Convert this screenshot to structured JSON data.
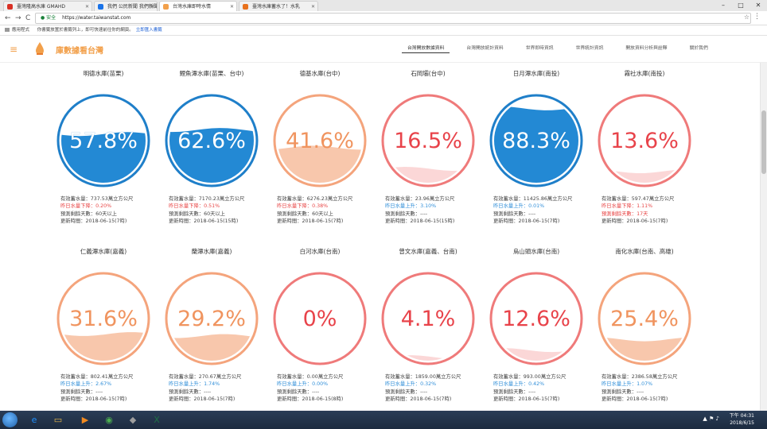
{
  "browser": {
    "tabs": [
      {
        "label": "臺灣隆高水庫 GMAHD",
        "color": "#d93025"
      },
      {
        "label": "我們 公民新聞 我們新聞",
        "color": "#1a73e8"
      },
      {
        "label": "台灣水庫即時水情",
        "color": "#f2a04b",
        "active": true
      },
      {
        "label": "臺灣水庫蓄水了！水乳",
        "color": "#e8711c"
      }
    ],
    "nav_back": "←",
    "nav_forward": "→",
    "nav_reload": "C",
    "secure_label": "● 安全",
    "url": "https://water.taiwanstat.com",
    "bookmarks_label": "應用程式",
    "bookmarks_text": "你書籤放置於書籤列上，即可快速前往你的網頁。",
    "bookmarks_link": "立即匯入書籤"
  },
  "site": {
    "title": "庫數據看台灣",
    "nav": [
      {
        "label": "台灣開放數據資料",
        "active": true
      },
      {
        "label": "台灣開放統計資料"
      },
      {
        "label": "世界即時資訊"
      },
      {
        "label": "世界統計資訊"
      },
      {
        "label": "開放資料分析與詮釋"
      },
      {
        "label": "關於我們"
      }
    ]
  },
  "labels": {
    "storage_prefix": "有效蓄水量：",
    "storage_unit": "萬立方公尺",
    "days_prefix": "預測剩餘天數：",
    "update_prefix": "更新時間："
  },
  "reservoirs": [
    {
      "name": "明德水庫(苗栗)",
      "percent": 57.8,
      "percent_text": "57.8%",
      "storage": "737.53",
      "change_text": "昨日水量下降：0.20%",
      "change_dir": "down",
      "days": "60天以上",
      "updated": "2018-06-15(7時)"
    },
    {
      "name": "鯉魚潭水庫(苗栗、台中)",
      "percent": 62.6,
      "percent_text": "62.6%",
      "storage": "7170.23",
      "change_text": "昨日水量下降：0.51%",
      "change_dir": "down",
      "days": "60天以上",
      "updated": "2018-06-15(15時)"
    },
    {
      "name": "德基水庫(台中)",
      "percent": 41.6,
      "percent_text": "41.6%",
      "storage": "6276.23",
      "change_text": "昨日水量下降：0.38%",
      "change_dir": "down",
      "days": "60天以上",
      "updated": "2018-06-15(7時)"
    },
    {
      "name": "石岡壩(台中)",
      "percent": 16.5,
      "percent_text": "16.5%",
      "storage": "23.96",
      "change_text": "昨日水量上升：3.10%",
      "change_dir": "up",
      "days": "----",
      "updated": "2018-06-15(15時)"
    },
    {
      "name": "日月潭水庫(南投)",
      "percent": 88.3,
      "percent_text": "88.3%",
      "storage": "11425.86",
      "change_text": "昨日水量上升：0.01%",
      "change_dir": "up",
      "days": "----",
      "updated": "2018-06-15(7時)"
    },
    {
      "name": "霧社水庫(南投)",
      "percent": 13.6,
      "percent_text": "13.6%",
      "storage": "597.47",
      "change_text": "昨日水量下降：1.11%",
      "change_dir": "down",
      "days": "17天",
      "days_warn": true,
      "updated": "2018-06-15(7時)"
    },
    {
      "name": "仁義潭水庫(嘉義)",
      "percent": 31.6,
      "percent_text": "31.6%",
      "storage": "802.41",
      "change_text": "昨日水量上升：2.67%",
      "change_dir": "up",
      "days": "----",
      "updated": "2018-06-15(7時)"
    },
    {
      "name": "蘭潭水庫(嘉義)",
      "percent": 29.2,
      "percent_text": "29.2%",
      "storage": "270.67",
      "change_text": "昨日水量上升：1.74%",
      "change_dir": "up",
      "days": "----",
      "updated": "2018-06-15(7時)"
    },
    {
      "name": "白河水庫(台南)",
      "percent": 0,
      "percent_text": "0%",
      "storage": "0.00",
      "change_text": "昨日水量上升：0.00%",
      "change_dir": "up",
      "days": "----",
      "updated": "2018-06-15(8時)"
    },
    {
      "name": "曾文水庫(嘉義、台南)",
      "percent": 4.1,
      "percent_text": "4.1%",
      "storage": "1859.00",
      "change_text": "昨日水量上升：0.32%",
      "change_dir": "up",
      "days": "----",
      "updated": "2018-06-15(7時)"
    },
    {
      "name": "烏山頭水庫(台南)",
      "percent": 12.6,
      "percent_text": "12.6%",
      "storage": "993.00",
      "change_text": "昨日水量上升：0.42%",
      "change_dir": "up",
      "days": "----",
      "updated": "2018-06-15(7時)"
    },
    {
      "name": "南化水庫(台南、高雄)",
      "percent": 25.4,
      "percent_text": "25.4%",
      "storage": "2386.58",
      "change_text": "昨日水量上升：1.07%",
      "change_dir": "up",
      "days": "----",
      "updated": "2018-06-15(7時)"
    }
  ],
  "colors": {
    "high_ring": "#1f7fc9",
    "high_fill": "#2389d4",
    "mid_ring": "#f4a47c",
    "mid_fill": "#f8c7ac",
    "mid_text": "#f0945f",
    "low_ring": "#ef7a7a",
    "low_fill": "#fbd7d7",
    "low_text": "#e8434a"
  },
  "taskbar": {
    "time": "下午 04:31",
    "date": "2018/6/15",
    "apps": [
      {
        "icon": "ie-icon",
        "glyph": "e",
        "color": "#1e90ff"
      },
      {
        "icon": "folder-icon",
        "glyph": "▭",
        "color": "#e8b84a"
      },
      {
        "icon": "media-icon",
        "glyph": "▶",
        "color": "#f28b20"
      },
      {
        "icon": "chrome-icon",
        "glyph": "◉",
        "color": "#4caf50"
      },
      {
        "icon": "app-icon",
        "glyph": "◆",
        "color": "#9e9e9e"
      },
      {
        "icon": "excel-icon",
        "glyph": "X",
        "color": "#1e7145"
      }
    ]
  }
}
